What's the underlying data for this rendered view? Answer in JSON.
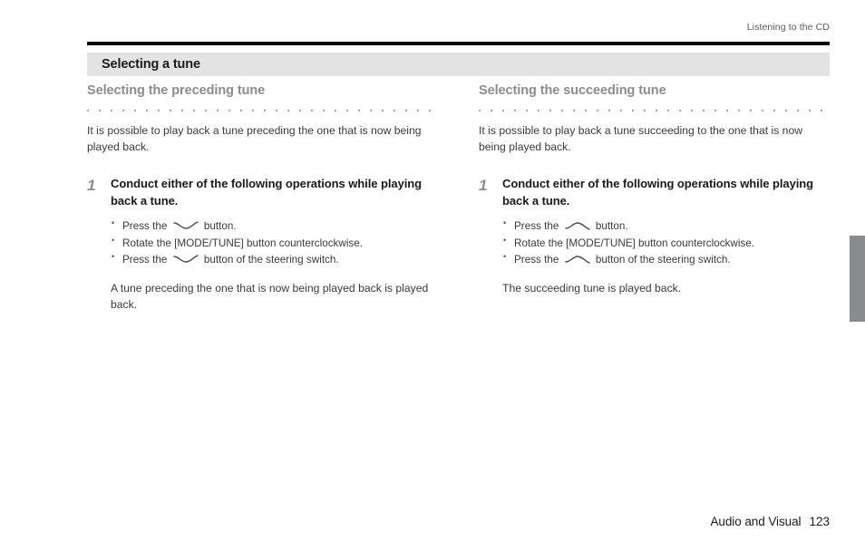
{
  "header": {
    "running_head": "Listening to the CD"
  },
  "banner": {
    "title": "Selecting a tune"
  },
  "columns": [
    {
      "heading": "Selecting the preceding tune",
      "intro": "It is possible to play back a tune preceding the one that is now being played back.",
      "step": {
        "number": "1",
        "title": "Conduct either of the following operations while playing back a tune.",
        "bullets": [
          {
            "before": "Press the",
            "icon": "seek-down-wave-icon",
            "after": "button."
          },
          {
            "before": "Rotate the [MODE/TUNE] button counterclockwise.",
            "icon": "",
            "after": ""
          },
          {
            "before": "Press the",
            "icon": "seek-down-wave-icon",
            "after": "button of the steering switch."
          }
        ],
        "result": "A tune preceding the one that is now being played back is played back."
      }
    },
    {
      "heading": "Selecting the succeeding tune",
      "intro": "It is possible to play back a tune succeeding to the one that is now being played back.",
      "step": {
        "number": "1",
        "title": "Conduct either of the following operations while playing back a tune.",
        "bullets": [
          {
            "before": "Press the",
            "icon": "seek-up-wave-icon",
            "after": "button."
          },
          {
            "before": "Rotate the [MODE/TUNE] button counterclockwise.",
            "icon": "",
            "after": ""
          },
          {
            "before": "Press the",
            "icon": "seek-up-wave-icon",
            "after": "button of the steering switch."
          }
        ],
        "result": "The succeeding tune is played back."
      }
    }
  ],
  "footer": {
    "section": "Audio and Visual",
    "page_number": "123"
  },
  "colors": {
    "banner_bg": "#e3e3e3",
    "rule_black": "#000000",
    "subheading_gray": "#8c8c8c",
    "dot_gray": "#a8a8a8",
    "thumb_tab_gray": "#898c8e",
    "body_text": "#3a3a3a"
  }
}
